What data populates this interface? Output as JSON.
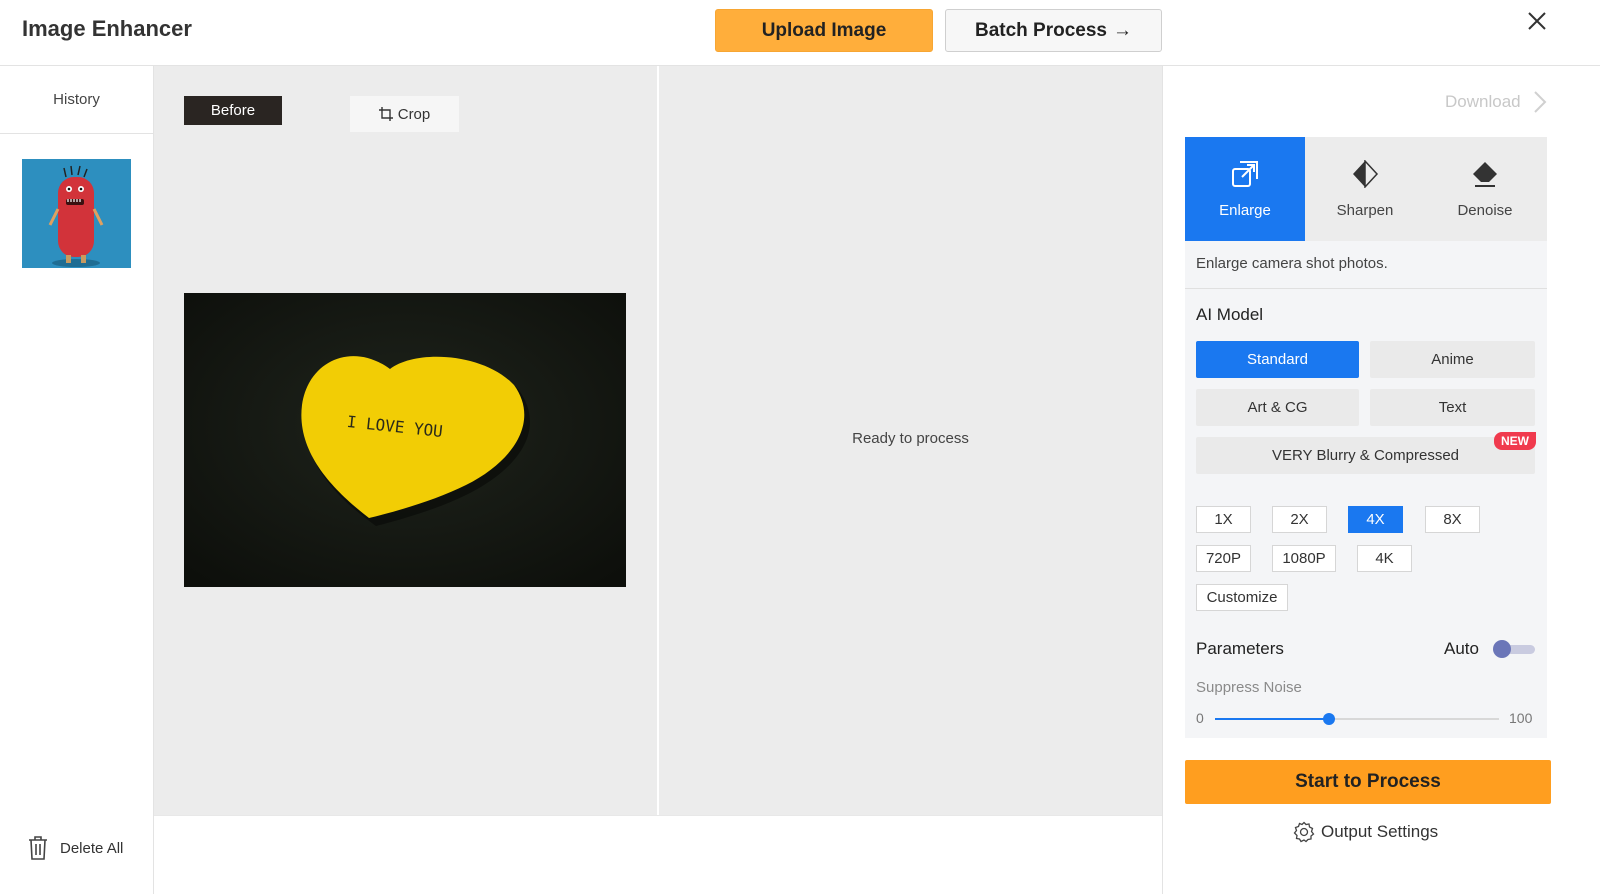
{
  "header": {
    "title": "Image Enhancer",
    "upload_label": "Upload Image",
    "batch_label": "Batch Process",
    "batch_arrow": "→"
  },
  "sidebar": {
    "history_label": "History",
    "delete_all_label": "Delete All"
  },
  "preview": {
    "before_label": "Before",
    "crop_label": "Crop",
    "photo_text": "I LOVE YOU",
    "ready_text": "Ready to process"
  },
  "panel": {
    "download_label": "Download",
    "tabs": [
      {
        "label": "Enlarge",
        "icon": "enlarge-icon",
        "active": true
      },
      {
        "label": "Sharpen",
        "icon": "sharpen-icon",
        "active": false
      },
      {
        "label": "Denoise",
        "icon": "denoise-icon",
        "active": false
      }
    ],
    "tab_description": "Enlarge camera shot photos.",
    "model_title": "AI Model",
    "models": [
      {
        "label": "Standard",
        "active": true
      },
      {
        "label": "Anime",
        "active": false
      },
      {
        "label": "Art & CG",
        "active": false
      },
      {
        "label": "Text",
        "active": false
      },
      {
        "label": "VERY Blurry & Compressed",
        "active": false,
        "badge": "NEW"
      }
    ],
    "scales": [
      {
        "label": "1X",
        "active": false
      },
      {
        "label": "2X",
        "active": false
      },
      {
        "label": "4X",
        "active": true
      },
      {
        "label": "8X",
        "active": false
      },
      {
        "label": "720P",
        "active": false
      },
      {
        "label": "1080P",
        "active": false
      },
      {
        "label": "4K",
        "active": false
      },
      {
        "label": "Customize",
        "active": false
      }
    ],
    "parameters_title": "Parameters",
    "auto_label": "Auto",
    "auto_enabled": false,
    "suppress_noise": {
      "label": "Suppress Noise",
      "min": "0",
      "max": "100",
      "value": 40
    },
    "start_label": "Start to Process",
    "output_settings_label": "Output Settings"
  },
  "colors": {
    "accent": "#1a78f0",
    "upload": "#ffae3b",
    "start": "#ff9e1f",
    "badge": "#f03a4e"
  }
}
